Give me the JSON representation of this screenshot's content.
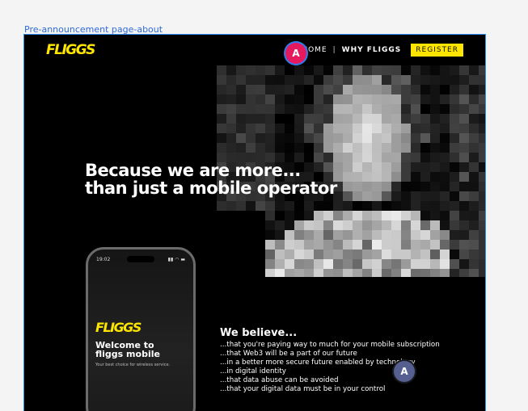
{
  "frame": {
    "label": "Pre-announcement page-about"
  },
  "header": {
    "logo": "FLIGGS",
    "nav": [
      {
        "label": "HOME"
      },
      {
        "label": "WHY FLIGGS"
      }
    ],
    "separator": "|",
    "register_label": "REGISTER"
  },
  "badges": {
    "primary": "A",
    "secondary": "A"
  },
  "hero": {
    "line1": "Because we are more...",
    "line2": "than just a mobile operator"
  },
  "phone": {
    "time": "19:02",
    "logo": "FLIGGS",
    "welcome_line1": "Welcome to",
    "welcome_line2": "fliggs mobile",
    "tagline": "Your best choice for wireless service."
  },
  "believe": {
    "title": "We believe...",
    "items": [
      "...that you're paying way to much for your mobile subscription",
      "...that Web3 will be a part of our future",
      "...in a better more secure future enabled by technology",
      "...in digital identity",
      "...that data abuse can be avoided",
      "...that your digital data must be in your control"
    ]
  },
  "colors": {
    "accent": "#ffe600",
    "badge_pink": "#e5195e",
    "badge_slate": "#556091",
    "frame_border": "#2f8df2"
  }
}
